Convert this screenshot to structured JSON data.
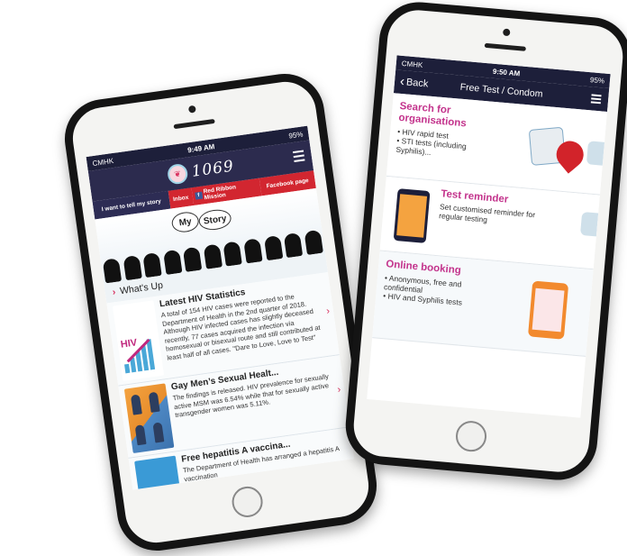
{
  "left_phone": {
    "status": {
      "carrier": "CMHK",
      "time": "9:49 AM",
      "battery": "95%"
    },
    "app_logo_text": "1069",
    "links": {
      "story": "I want to tell my story",
      "inbox": "Inbox",
      "red_ribbon": "Red Ribbon Mission",
      "facebook": "Facebook page"
    },
    "banner": {
      "my": "My",
      "story": "Story"
    },
    "section": "What's Up",
    "news": [
      {
        "title": "Latest HIV Statistics",
        "thumb_label": "HIV",
        "body": "A total of 154 HIV cases were reported to the Department of Health in the 2nd quarter of 2018. Although HIV infected cases has slightly deceased recently, 77 cases acquired the infection via homosexual or bisexual route and still contributed at least half of all cases. \"Dare to Love, Love to Test\""
      },
      {
        "title": "Gay Men’s Sexual Healt...",
        "body": "The findings is released. HIV prevalence for sexually active MSM was 6.54% while that for sexually active transgender women was 5.11%."
      },
      {
        "title": "Free hepatitis A vaccina...",
        "body": "The Department of Health has arranged a hepatitis A vaccination"
      }
    ]
  },
  "right_phone": {
    "status": {
      "carrier": "CMHK",
      "time": "9:50 AM",
      "battery": "95%"
    },
    "nav": {
      "back": "Back",
      "title": "Free Test / Condom"
    },
    "services": [
      {
        "title": "Search for organisations",
        "items": [
          "HIV rapid test",
          "STI tests (including Syphilis)..."
        ]
      },
      {
        "title": "Test reminder",
        "description": "Set customised reminder for regular testing"
      },
      {
        "title": "Online booking",
        "items": [
          "Anonymous, free and confidential",
          "HIV and Syphilis tests"
        ]
      }
    ]
  },
  "colors": {
    "navy": "#1d1f3a",
    "accent_pink": "#c3338c",
    "red": "#d22630"
  }
}
